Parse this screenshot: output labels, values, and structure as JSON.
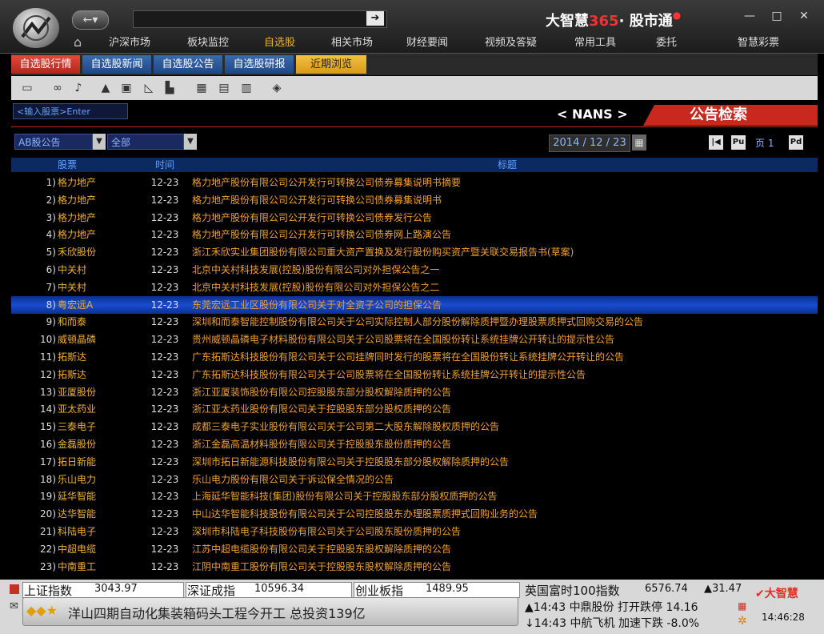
{
  "header": {
    "brand_name": "大智慧",
    "brand_number": "365",
    "brand_dot": "·",
    "brand_product": "股市通",
    "brand_badge": "●",
    "back_icon": "back-arrow-icon",
    "go_icon": "go-arrow-icon",
    "menu": [
      {
        "label": "沪深市场",
        "active": false
      },
      {
        "label": "板块监控",
        "active": false
      },
      {
        "label": "自选股",
        "active": true
      },
      {
        "label": "相关市场",
        "active": false
      },
      {
        "label": "财经要闻",
        "active": false
      },
      {
        "label": "视频及答疑",
        "active": false
      },
      {
        "label": "常用工具",
        "active": false
      },
      {
        "label": "委托",
        "active": false
      },
      {
        "label": "智慧彩票",
        "active": false
      }
    ]
  },
  "subtabs": [
    {
      "label": "自选股行情"
    },
    {
      "label": "自选股新闻"
    },
    {
      "label": "自选股公告"
    },
    {
      "label": "自选股研报"
    },
    {
      "label": "近期浏览"
    }
  ],
  "search": {
    "code_placeholder": "<输入股票>Enter",
    "nans_label": "< NANS >",
    "panel_title": "公告检索",
    "category_value": "AB股公告",
    "scope_value": "全部",
    "date_value": "2014 / 12 / 23",
    "page_label": "页 1",
    "first_page_label": "|◀",
    "prev_page_label": "Pu",
    "next_page_label": "Pd"
  },
  "table": {
    "columns": [
      "股票",
      "时间",
      "标题"
    ],
    "selected_index": 7,
    "rows": [
      {
        "num": "1)",
        "name": "格力地产",
        "date": "12-23",
        "title": "格力地产股份有限公司公开发行可转换公司债券募集说明书摘要"
      },
      {
        "num": "2)",
        "name": "格力地产",
        "date": "12-23",
        "title": "格力地产股份有限公司公开发行可转换公司债券募集说明书"
      },
      {
        "num": "3)",
        "name": "格力地产",
        "date": "12-23",
        "title": "格力地产股份有限公司公开发行可转换公司债券发行公告"
      },
      {
        "num": "4)",
        "name": "格力地产",
        "date": "12-23",
        "title": "格力地产股份有限公司公开发行可转换公司债券网上路演公告"
      },
      {
        "num": "5)",
        "name": "禾欣股份",
        "date": "12-23",
        "title": "浙江禾欣实业集团股份有限公司重大资产置换及发行股份购买资产暨关联交易报告书(草案)"
      },
      {
        "num": "6)",
        "name": "中关村",
        "date": "12-23",
        "title": "北京中关村科技发展(控股)股份有限公司对外担保公告之一"
      },
      {
        "num": "7)",
        "name": "中关村",
        "date": "12-23",
        "title": "北京中关村科技发展(控股)股份有限公司对外担保公告之二"
      },
      {
        "num": "8)",
        "name": "粤宏远A",
        "date": "12-23",
        "title": "东莞宏远工业区股份有限公司关于对全资子公司的担保公告"
      },
      {
        "num": "9)",
        "name": "和而泰",
        "date": "12-23",
        "title": "深圳和而泰智能控制股份有限公司关于公司实际控制人部分股份解除质押暨办理股票质押式回购交易的公告"
      },
      {
        "num": "10)",
        "name": "威顿晶磷",
        "date": "12-23",
        "title": "贵州威顿晶磷电子材料股份有限公司关于公司股票将在全国股份转让系统挂牌公开转让的提示性公告"
      },
      {
        "num": "11)",
        "name": "拓斯达",
        "date": "12-23",
        "title": "广东拓斯达科技股份有限公司关于公司挂牌同时发行的股票将在全国股份转让系统挂牌公开转让的公告"
      },
      {
        "num": "12)",
        "name": "拓斯达",
        "date": "12-23",
        "title": "广东拓斯达科技股份有限公司关于公司股票将在全国股份转让系统挂牌公开转让的提示性公告"
      },
      {
        "num": "13)",
        "name": "亚厦股份",
        "date": "12-23",
        "title": "浙江亚厦装饰股份有限公司控股股东部分股权解除质押的公告"
      },
      {
        "num": "14)",
        "name": "亚太药业",
        "date": "12-23",
        "title": "浙江亚太药业股份有限公司关于控股股东部分股权质押的公告"
      },
      {
        "num": "15)",
        "name": "三泰电子",
        "date": "12-23",
        "title": "成都三泰电子实业股份有限公司关于公司第二大股东解除股权质押的公告"
      },
      {
        "num": "16)",
        "name": "金磊股份",
        "date": "12-23",
        "title": "浙江金磊高温材料股份有限公司关于控股股东股份质押的公告"
      },
      {
        "num": "17)",
        "name": "拓日新能",
        "date": "12-23",
        "title": "深圳市拓日新能源科技股份有限公司关于控股股东部分股权解除质押的公告"
      },
      {
        "num": "18)",
        "name": "乐山电力",
        "date": "12-23",
        "title": "乐山电力股份有限公司关于诉讼保全情况的公告"
      },
      {
        "num": "19)",
        "name": "延华智能",
        "date": "12-23",
        "title": "上海延华智能科技(集团)股份有限公司关于控股股东部分股权质押的公告"
      },
      {
        "num": "20)",
        "name": "达华智能",
        "date": "12-23",
        "title": "中山达华智能科技股份有限公司关于公司控股股东办理股票质押式回购业务的公告"
      },
      {
        "num": "21)",
        "name": "科陆电子",
        "date": "12-23",
        "title": "深圳市科陆电子科技股份有限公司关于公司股东股份质押的公告"
      },
      {
        "num": "22)",
        "name": "中超电缆",
        "date": "12-23",
        "title": "江苏中超电缆股份有限公司关于控股股东股权解除质押的公告"
      },
      {
        "num": "23)",
        "name": "中南重工",
        "date": "12-23",
        "title": "江阴中南重工股份有限公司关于控股股东股权解除质押的公告"
      }
    ]
  },
  "ticker": {
    "sh_label": "上证指数",
    "sh_value": "3043.97",
    "sz_label": "深证成指",
    "sz_value": "10596.34",
    "cy_label": "创业板指",
    "cy_value": "1489.95",
    "uk_label": "英国富时100指数",
    "uk_value": "6576.74",
    "uk_change": "▲31.47",
    "alert1": "▲14:43 中鼎股份 打开跌停 14.16",
    "alert2": "↓14:43 中航飞机 加速下跌 -8.0%",
    "news": "洋山四期自动化集装箱码头工程今开工 总投资139亿",
    "news_icons": "◆◆★",
    "brand": "大智慧",
    "clock": "14:46:28"
  },
  "colors": {
    "accent_gold": "#f0b030",
    "panel_red": "#c8281e",
    "row_select": "#1a4cd0",
    "column_blue": "#5fa0ff"
  }
}
